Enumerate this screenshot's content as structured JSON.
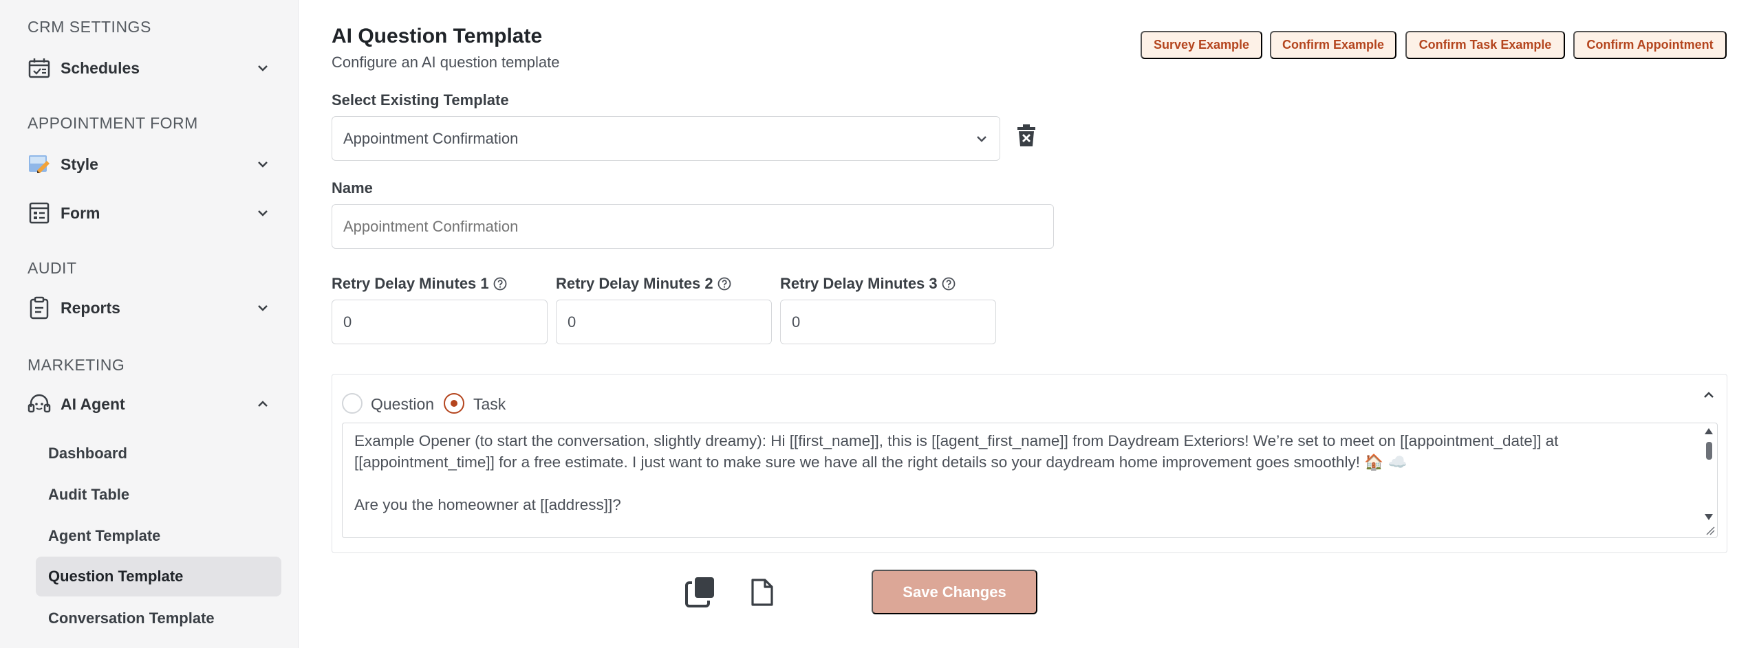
{
  "sidebar": {
    "sections": [
      {
        "title": "CRM SETTINGS"
      },
      {
        "title": "APPOINTMENT FORM"
      },
      {
        "title": "AUDIT"
      },
      {
        "title": "MARKETING"
      }
    ],
    "items": {
      "schedules": "Schedules",
      "style": "Style",
      "form": "Form",
      "reports": "Reports",
      "ai_agent": "AI Agent"
    },
    "ai_agent_sub": [
      "Dashboard",
      "Audit Table",
      "Agent Template",
      "Question Template",
      "Conversation Template"
    ],
    "active_sub": "Question Template"
  },
  "header": {
    "title": "AI Question Template",
    "subtitle": "Configure an AI question template"
  },
  "examples": [
    "Survey Example",
    "Confirm Example",
    "Confirm Task Example",
    "Confirm Appointment"
  ],
  "form": {
    "select_label": "Select Existing Template",
    "select_value": "Appointment Confirmation",
    "name_label": "Name",
    "name_placeholder": "Appointment Confirmation",
    "retry1_label": "Retry Delay Minutes 1",
    "retry2_label": "Retry Delay Minutes 2",
    "retry3_label": "Retry Delay Minutes 3",
    "retry1_value": "0",
    "retry2_value": "0",
    "retry3_value": "0"
  },
  "panel": {
    "option_question": "Question",
    "option_task": "Task",
    "selected": "Task",
    "text": "Example Opener (to start the conversation, slightly dreamy): Hi [[first_name]], this is [[agent_first_name]] from Daydream Exteriors! We’re set to meet on [[appointment_date]] at [[appointment_time]] for a free estimate. I just want to make sure we have all the right details so your daydream home improvement goes smoothly! 🏠 ☁️\n\nAre you the homeowner at [[address]]?"
  },
  "actions": {
    "save_label": "Save Changes"
  },
  "colors": {
    "accent": "#b4451e",
    "example_bg": "#fdf1e7",
    "save_disabled_bg": "#dca797",
    "sidebar_bg": "#f5f5f6"
  }
}
